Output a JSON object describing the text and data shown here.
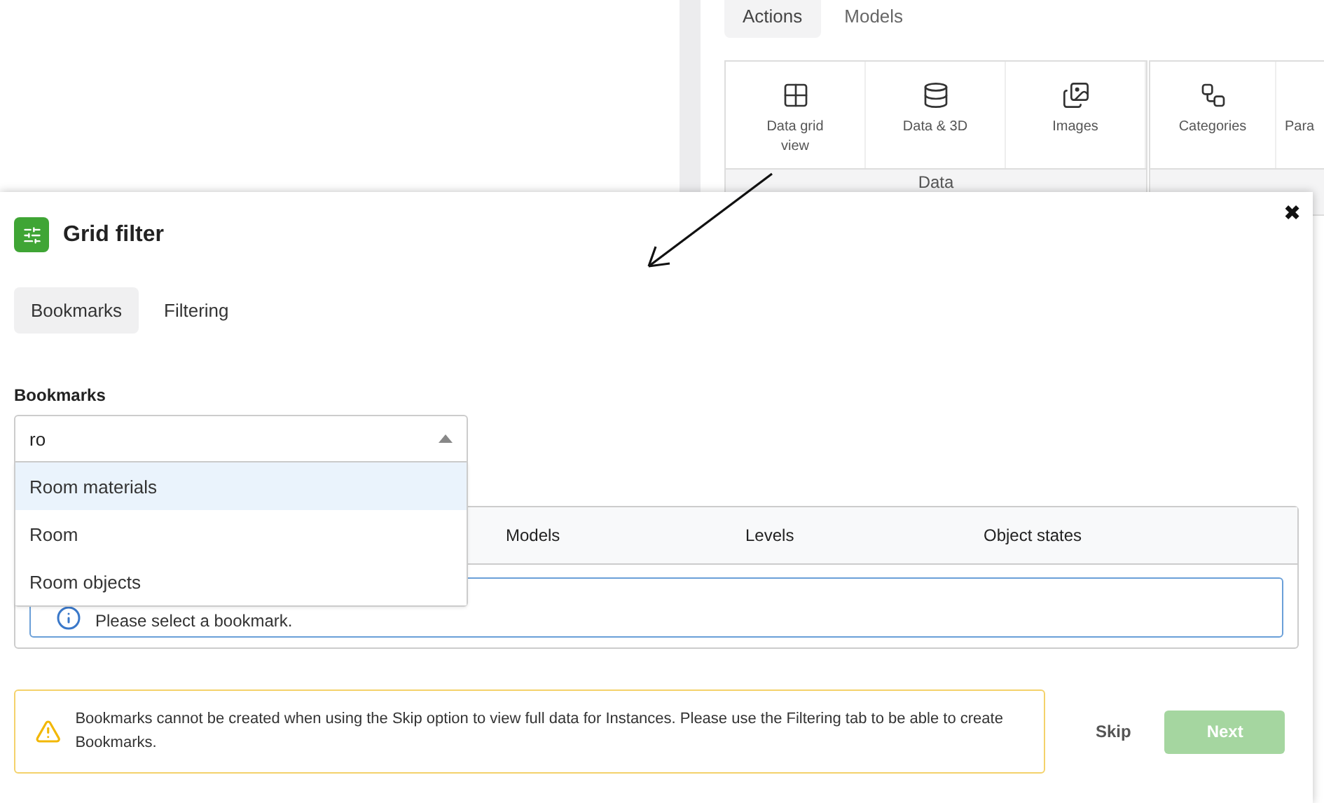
{
  "background": {
    "tabs": [
      {
        "label": "Actions",
        "selected": true
      },
      {
        "label": "Models",
        "selected": false
      }
    ],
    "ribbon": [
      {
        "label": "Data",
        "items": [
          "Data grid view",
          "Data & 3D",
          "Images"
        ]
      },
      {
        "items": [
          "Categories",
          "Para"
        ]
      }
    ]
  },
  "dialog": {
    "title": "Grid filter",
    "close": "✖",
    "tabs": [
      {
        "label": "Bookmarks",
        "selected": true
      },
      {
        "label": "Filtering",
        "selected": false
      }
    ],
    "bookmarks_label": "Bookmarks",
    "bookmarks_value": "ro",
    "dropdown_expanded": true,
    "options": [
      {
        "label": "Room materials",
        "selected": true
      },
      {
        "label": "Room",
        "selected": false
      },
      {
        "label": "Room objects",
        "selected": false
      }
    ],
    "table": {
      "columns": [
        "Models",
        "Levels",
        "Object states"
      ],
      "info": "Please select a bookmark."
    },
    "warning": "Bookmarks cannot be created when using the Skip option to view full data for Instances. Please use the Filtering tab to be able to create Bookmarks.",
    "buttons": [
      {
        "label": "Skip",
        "kind": "link",
        "disabled": false
      },
      {
        "label": "Next",
        "kind": "primary",
        "disabled": true
      }
    ]
  }
}
